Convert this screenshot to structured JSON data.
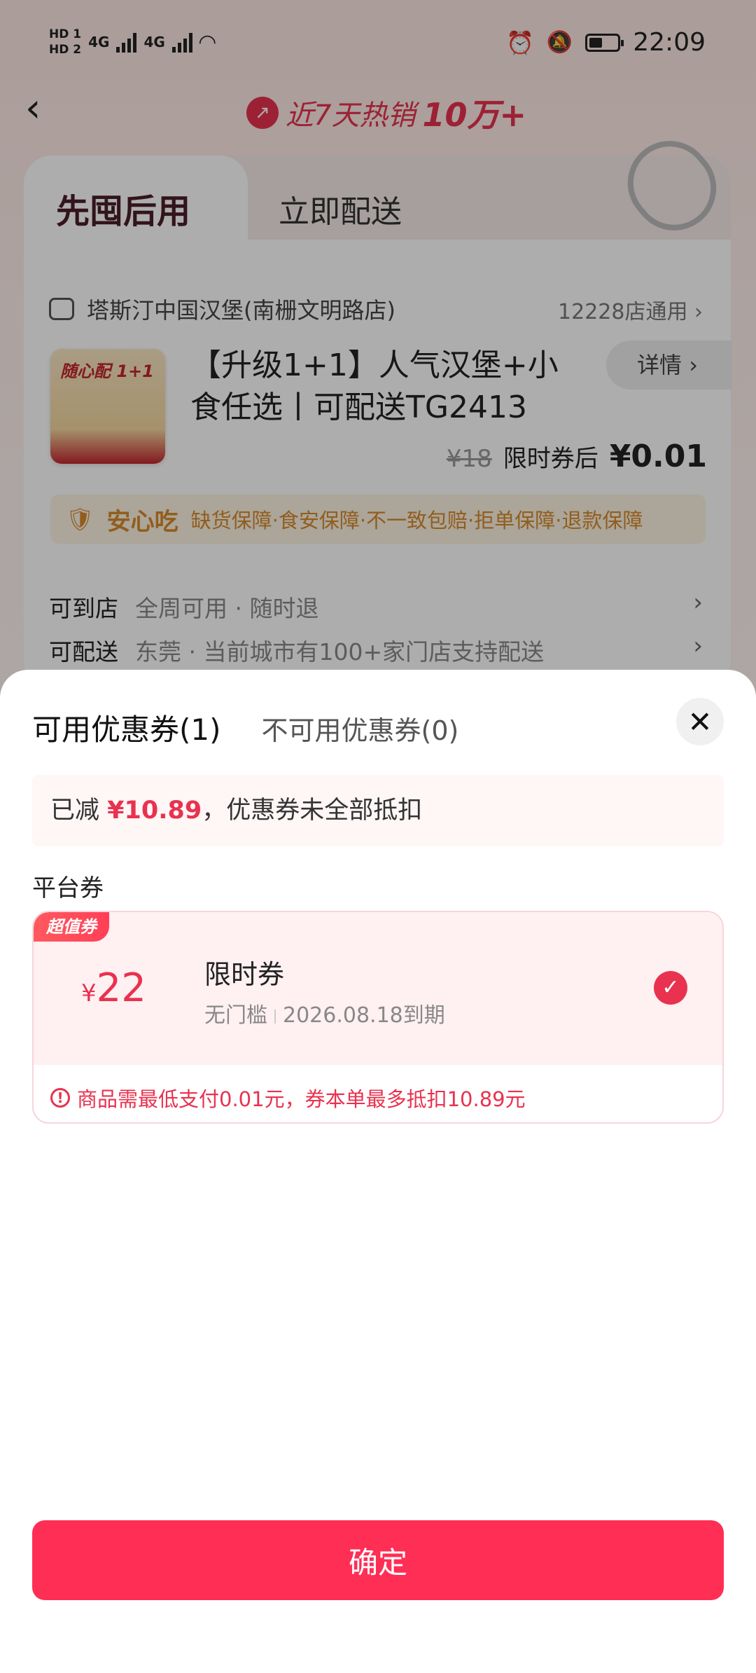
{
  "status_bar": {
    "hd1": "HD 1",
    "hd2": "HD 2",
    "net1": "4G",
    "net2": "4G",
    "time": "22:09"
  },
  "nav": {
    "hot_prefix": "近7天热销",
    "hot_number": "10万+"
  },
  "page_tabs": {
    "active": "先囤后用",
    "other": "立即配送"
  },
  "store": {
    "name": "塔斯汀中国汉堡(南栅文明路店)",
    "availability": "12228店通用"
  },
  "product": {
    "thumb_title": "随心配 1+1",
    "title": "【升级1+1】人气汉堡+小食任选丨可配送TG2413",
    "detail_label": "详情",
    "original_price": "¥18",
    "after_label": "限时券后",
    "after_price": "¥0.01"
  },
  "guarantee": {
    "title": "安心吃",
    "desc": "缺货保障·食安保障·不一致包赔·拒单保障·退款保障"
  },
  "rows": [
    {
      "label": "可到店",
      "value": "全周可用 · 随时退"
    },
    {
      "label": "可配送",
      "value": "东莞 · 当前城市有100+家门店支持配送"
    }
  ],
  "sheet": {
    "tab_available": "可用优惠券(1)",
    "tab_unavailable": "不可用优惠券(0)",
    "summary_prefix": "已减",
    "summary_amount": "¥10.89",
    "summary_suffix": "，优惠券未全部抵扣",
    "section_title": "平台券",
    "coupon": {
      "tag": "超值券",
      "currency": "¥",
      "value": "22",
      "name": "限时券",
      "threshold": "无门槛",
      "expiry": "2026.08.18到期",
      "selected": true
    },
    "warning": "商品需最低支付0.01元，券本单最多抵扣10.89元",
    "confirm": "确定"
  },
  "colors": {
    "accent": "#e8324f",
    "button": "#ff2e55"
  }
}
